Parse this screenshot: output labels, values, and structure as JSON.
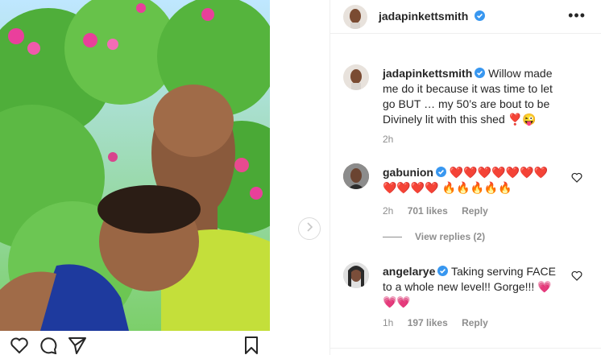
{
  "post": {
    "username": "jadapinkettsmith",
    "more_icon": "more-horizontal-icon",
    "verified_color": "#3897f0"
  },
  "caption": {
    "username": "jadapinkettsmith",
    "text": "Willow made me do it because it was time to let go BUT … my 50’s are bout to be Divinely lit with this shed ❣️😜",
    "time": "2h"
  },
  "comments": [
    {
      "username": "gabunion",
      "text": "❤️❤️❤️❤️❤️❤️❤️❤️❤️❤️❤️ 🔥🔥🔥🔥🔥",
      "time": "2h",
      "likes": "701 likes",
      "reply": "Reply",
      "view_replies": "View replies (2)"
    },
    {
      "username": "angelarye",
      "text": "Taking serving FACE to a whole new level!! Gorge!!! 💗💗💗",
      "time": "1h",
      "likes": "197 likes",
      "reply": "Reply"
    }
  ],
  "actions": {
    "icons": [
      "heart-icon",
      "comment-icon",
      "share-icon",
      "bookmark-icon"
    ]
  }
}
